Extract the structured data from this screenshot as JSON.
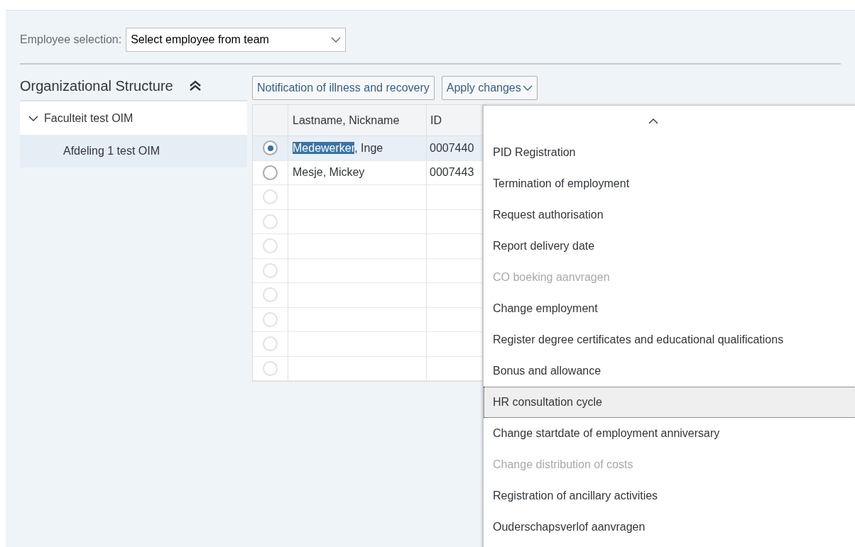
{
  "employee_selection": {
    "label": "Employee selection:",
    "value": "Select employee from team"
  },
  "org_structure": {
    "title": "Organizational Structure",
    "tree": [
      {
        "label": "Faculteit test OIM",
        "expanded": true,
        "selected": false,
        "children": [
          {
            "label": "Afdeling 1 test OIM",
            "selected": true
          }
        ]
      }
    ]
  },
  "toolbar": [
    {
      "label": "Notification of illness and recovery",
      "kind": "button"
    },
    {
      "label": "Apply changes",
      "kind": "menu"
    }
  ],
  "table": {
    "columns": [
      "Lastname, Nickname",
      "ID"
    ],
    "rows": [
      {
        "selected": true,
        "name_marked": "Medewerker",
        "name_rest": ", Inge",
        "id": "0007440"
      },
      {
        "selected": false,
        "name_marked": "",
        "name_rest": "Mesje, Mickey",
        "id": "0007443"
      },
      {
        "selected": false
      },
      {
        "selected": false
      },
      {
        "selected": false
      },
      {
        "selected": false
      },
      {
        "selected": false
      },
      {
        "selected": false
      },
      {
        "selected": false
      },
      {
        "selected": false
      }
    ]
  },
  "menu": {
    "items": [
      {
        "label": "PID Registration",
        "disabled": false,
        "focused": false
      },
      {
        "label": "Termination of employment",
        "disabled": false,
        "focused": false
      },
      {
        "label": "Request authorisation",
        "disabled": false,
        "focused": false
      },
      {
        "label": "Report delivery date",
        "disabled": false,
        "focused": false
      },
      {
        "label": "CO boeking aanvragen",
        "disabled": true,
        "focused": false
      },
      {
        "label": "Change employment",
        "disabled": false,
        "focused": false
      },
      {
        "label": "Register degree certificates and educational qualifications",
        "disabled": false,
        "focused": false
      },
      {
        "label": "Bonus and allowance",
        "disabled": false,
        "focused": false
      },
      {
        "label": "HR consultation cycle",
        "disabled": false,
        "focused": true
      },
      {
        "label": "Change startdate of employment anniversary",
        "disabled": false,
        "focused": false
      },
      {
        "label": "Change distribution of costs",
        "disabled": true,
        "focused": false
      },
      {
        "label": "Registration of ancillary activities",
        "disabled": false,
        "focused": false
      },
      {
        "label": "Ouderschapsverlof aanvragen",
        "disabled": false,
        "focused": false
      }
    ]
  }
}
